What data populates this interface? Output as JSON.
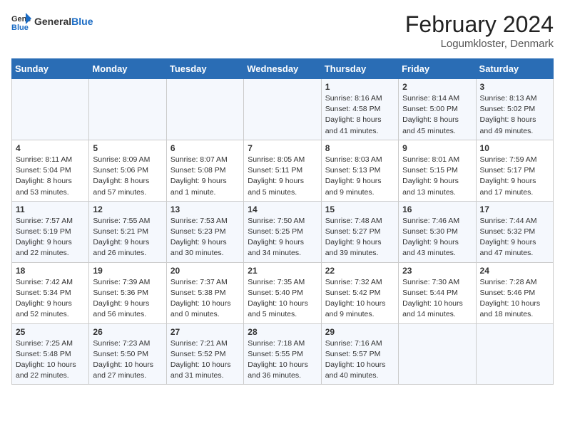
{
  "header": {
    "logo_general": "General",
    "logo_blue": "Blue",
    "month_year": "February 2024",
    "location": "Logumkloster, Denmark"
  },
  "days_of_week": [
    "Sunday",
    "Monday",
    "Tuesday",
    "Wednesday",
    "Thursday",
    "Friday",
    "Saturday"
  ],
  "weeks": [
    [
      {
        "day": "",
        "content": ""
      },
      {
        "day": "",
        "content": ""
      },
      {
        "day": "",
        "content": ""
      },
      {
        "day": "",
        "content": ""
      },
      {
        "day": "1",
        "content": "Sunrise: 8:16 AM\nSunset: 4:58 PM\nDaylight: 8 hours and 41 minutes."
      },
      {
        "day": "2",
        "content": "Sunrise: 8:14 AM\nSunset: 5:00 PM\nDaylight: 8 hours and 45 minutes."
      },
      {
        "day": "3",
        "content": "Sunrise: 8:13 AM\nSunset: 5:02 PM\nDaylight: 8 hours and 49 minutes."
      }
    ],
    [
      {
        "day": "4",
        "content": "Sunrise: 8:11 AM\nSunset: 5:04 PM\nDaylight: 8 hours and 53 minutes."
      },
      {
        "day": "5",
        "content": "Sunrise: 8:09 AM\nSunset: 5:06 PM\nDaylight: 8 hours and 57 minutes."
      },
      {
        "day": "6",
        "content": "Sunrise: 8:07 AM\nSunset: 5:08 PM\nDaylight: 9 hours and 1 minute."
      },
      {
        "day": "7",
        "content": "Sunrise: 8:05 AM\nSunset: 5:11 PM\nDaylight: 9 hours and 5 minutes."
      },
      {
        "day": "8",
        "content": "Sunrise: 8:03 AM\nSunset: 5:13 PM\nDaylight: 9 hours and 9 minutes."
      },
      {
        "day": "9",
        "content": "Sunrise: 8:01 AM\nSunset: 5:15 PM\nDaylight: 9 hours and 13 minutes."
      },
      {
        "day": "10",
        "content": "Sunrise: 7:59 AM\nSunset: 5:17 PM\nDaylight: 9 hours and 17 minutes."
      }
    ],
    [
      {
        "day": "11",
        "content": "Sunrise: 7:57 AM\nSunset: 5:19 PM\nDaylight: 9 hours and 22 minutes."
      },
      {
        "day": "12",
        "content": "Sunrise: 7:55 AM\nSunset: 5:21 PM\nDaylight: 9 hours and 26 minutes."
      },
      {
        "day": "13",
        "content": "Sunrise: 7:53 AM\nSunset: 5:23 PM\nDaylight: 9 hours and 30 minutes."
      },
      {
        "day": "14",
        "content": "Sunrise: 7:50 AM\nSunset: 5:25 PM\nDaylight: 9 hours and 34 minutes."
      },
      {
        "day": "15",
        "content": "Sunrise: 7:48 AM\nSunset: 5:27 PM\nDaylight: 9 hours and 39 minutes."
      },
      {
        "day": "16",
        "content": "Sunrise: 7:46 AM\nSunset: 5:30 PM\nDaylight: 9 hours and 43 minutes."
      },
      {
        "day": "17",
        "content": "Sunrise: 7:44 AM\nSunset: 5:32 PM\nDaylight: 9 hours and 47 minutes."
      }
    ],
    [
      {
        "day": "18",
        "content": "Sunrise: 7:42 AM\nSunset: 5:34 PM\nDaylight: 9 hours and 52 minutes."
      },
      {
        "day": "19",
        "content": "Sunrise: 7:39 AM\nSunset: 5:36 PM\nDaylight: 9 hours and 56 minutes."
      },
      {
        "day": "20",
        "content": "Sunrise: 7:37 AM\nSunset: 5:38 PM\nDaylight: 10 hours and 0 minutes."
      },
      {
        "day": "21",
        "content": "Sunrise: 7:35 AM\nSunset: 5:40 PM\nDaylight: 10 hours and 5 minutes."
      },
      {
        "day": "22",
        "content": "Sunrise: 7:32 AM\nSunset: 5:42 PM\nDaylight: 10 hours and 9 minutes."
      },
      {
        "day": "23",
        "content": "Sunrise: 7:30 AM\nSunset: 5:44 PM\nDaylight: 10 hours and 14 minutes."
      },
      {
        "day": "24",
        "content": "Sunrise: 7:28 AM\nSunset: 5:46 PM\nDaylight: 10 hours and 18 minutes."
      }
    ],
    [
      {
        "day": "25",
        "content": "Sunrise: 7:25 AM\nSunset: 5:48 PM\nDaylight: 10 hours and 22 minutes."
      },
      {
        "day": "26",
        "content": "Sunrise: 7:23 AM\nSunset: 5:50 PM\nDaylight: 10 hours and 27 minutes."
      },
      {
        "day": "27",
        "content": "Sunrise: 7:21 AM\nSunset: 5:52 PM\nDaylight: 10 hours and 31 minutes."
      },
      {
        "day": "28",
        "content": "Sunrise: 7:18 AM\nSunset: 5:55 PM\nDaylight: 10 hours and 36 minutes."
      },
      {
        "day": "29",
        "content": "Sunrise: 7:16 AM\nSunset: 5:57 PM\nDaylight: 10 hours and 40 minutes."
      },
      {
        "day": "",
        "content": ""
      },
      {
        "day": "",
        "content": ""
      }
    ]
  ]
}
